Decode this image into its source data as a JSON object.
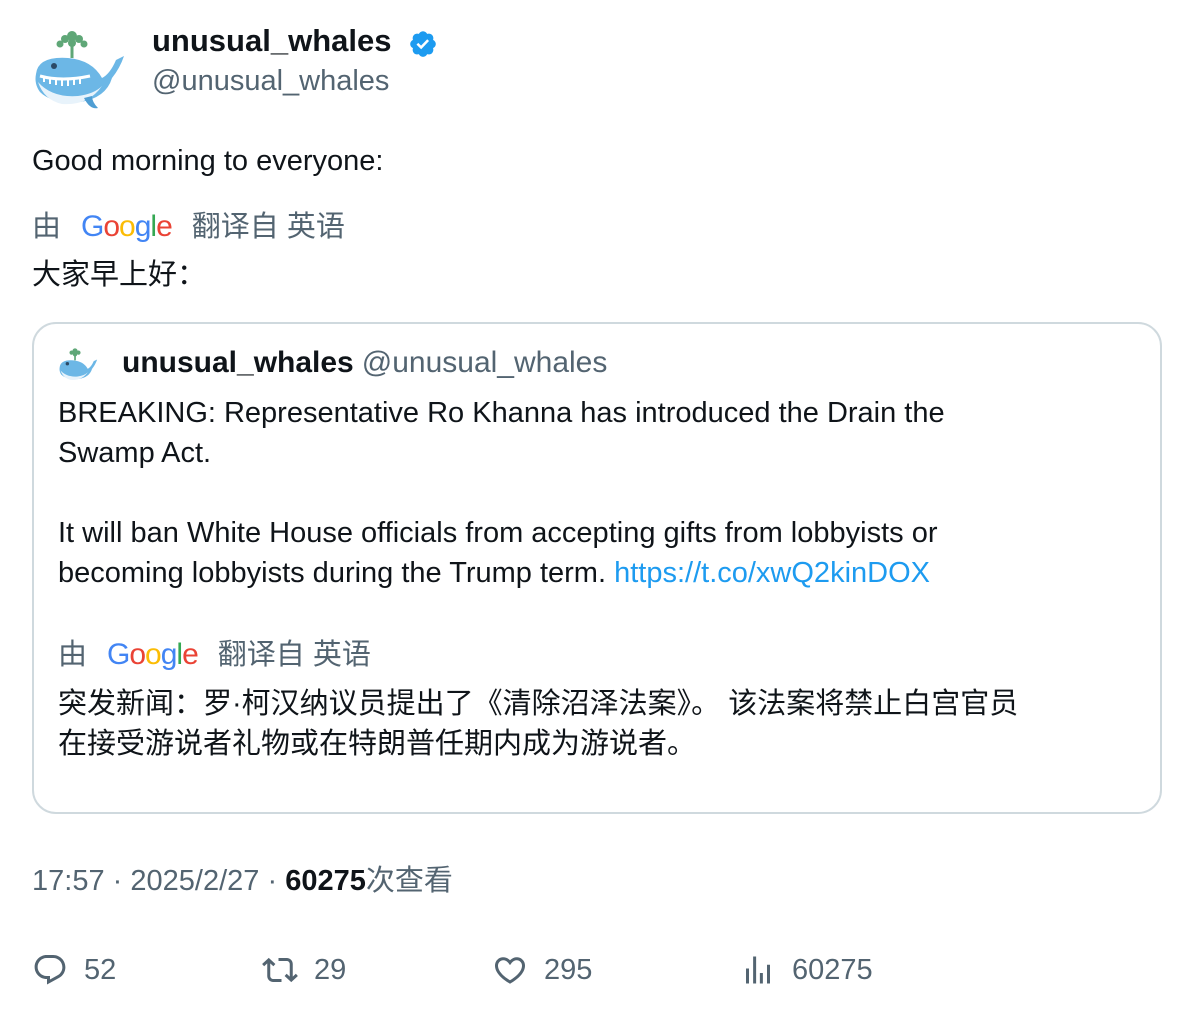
{
  "tweet": {
    "author_name": "unusual_whales",
    "author_handle": "@unusual_whales",
    "verified": true,
    "text": "Good morning to everyone:",
    "translate_by": "由",
    "translate_brand": "Google",
    "translate_from": "翻译自 英语",
    "translated_text": "大家早上好：",
    "time": "17:57",
    "date": "2025/2/27",
    "separator": "·",
    "views_count": "60275",
    "views_label": "次查看"
  },
  "quote": {
    "author_name": "unusual_whales",
    "author_handle": "@unusual_whales",
    "line1": "BREAKING: Representative Ro Khanna has introduced the Drain the",
    "line2": "Swamp Act.",
    "line3": "It will ban White House officials from accepting gifts from lobbyists or",
    "line4": "becoming lobbyists during the Trump term.",
    "link": "https://t.co/xwQ2kinDOX",
    "translate_by": "由",
    "translate_brand": "Google",
    "translate_from": "翻译自 英语",
    "translated_line1": "突发新闻：罗·柯汉纳议员提出了《清除沼泽法案》。 该法案将禁止白宫官员",
    "translated_line2": "在接受游说者礼物或在特朗普任期内成为游说者。"
  },
  "actions": {
    "replies": "52",
    "retweets": "29",
    "likes": "295",
    "views": "60275"
  },
  "colors": {
    "accent": "#1d9bf0",
    "secondary_text": "#536471",
    "border": "#cfd9de",
    "verified": "#1d9bf0"
  }
}
